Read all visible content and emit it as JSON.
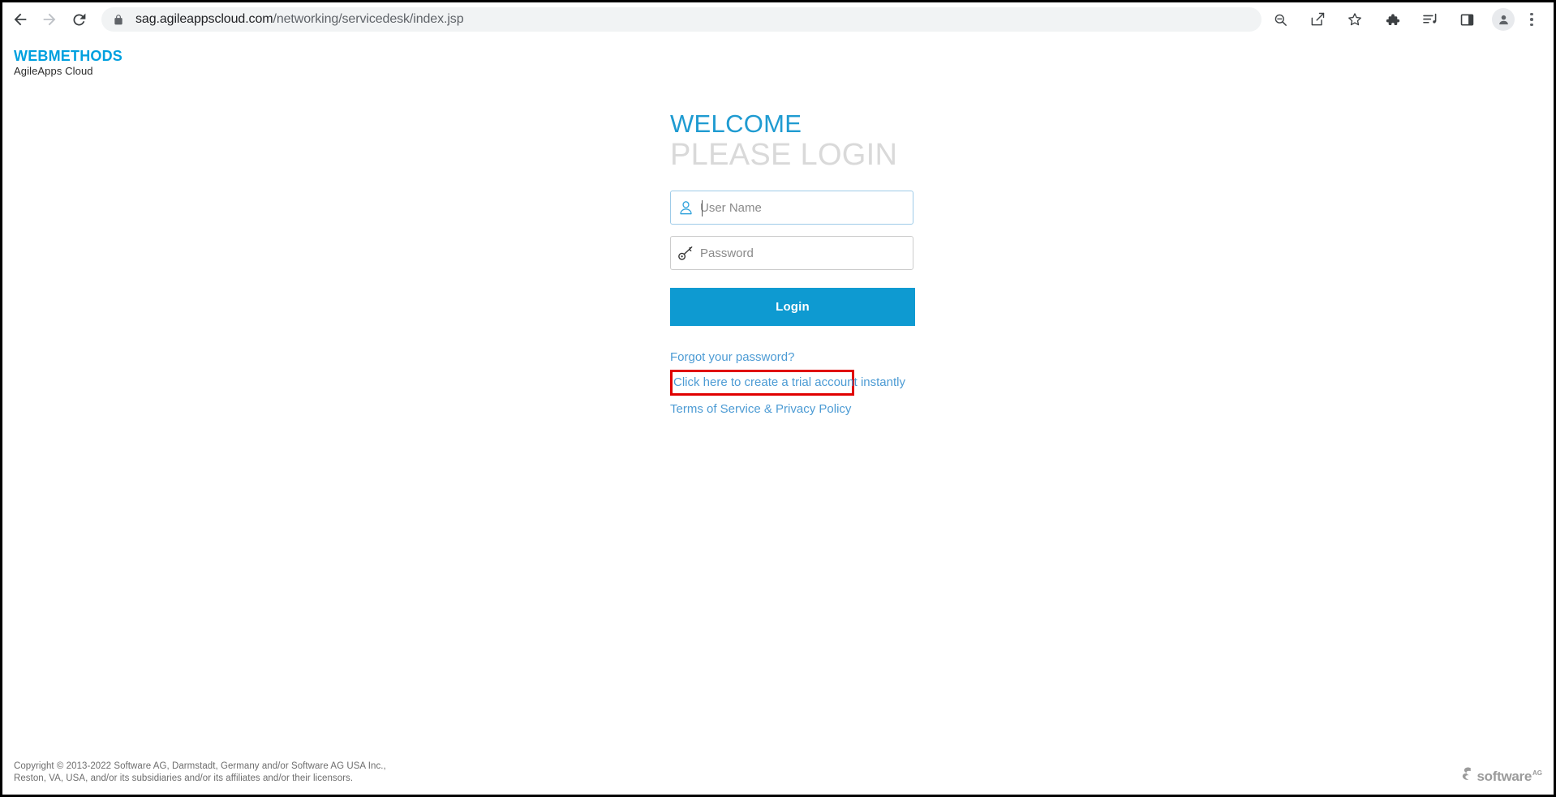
{
  "browser": {
    "back_label": "Back",
    "forward_label": "Forward",
    "reload_label": "Reload",
    "lock_label": "site-information",
    "url_host": "sag.agileappscloud.com",
    "url_path": "/networking/servicedesk/index.jsp",
    "url_full": "sag.agileappscloud.com/networking/servicedesk/index.jsp",
    "actions": [
      {
        "name": "zoom-out-icon",
        "label": "Zoom"
      },
      {
        "name": "share-icon",
        "label": "Share this page"
      },
      {
        "name": "bookmark-star-icon",
        "label": "Bookmark this tab"
      },
      {
        "name": "extensions-puzzle-icon",
        "label": "Extensions"
      },
      {
        "name": "media-playlist-icon",
        "label": "Media controls"
      },
      {
        "name": "side-panel-icon",
        "label": "Side panel"
      }
    ],
    "profile_label": "Profile",
    "menu_label": "Customize and control Google Chrome"
  },
  "brand": {
    "title": "WEBMETHODS",
    "subtitle": "AgileApps Cloud",
    "accent_color": "#00A0DF"
  },
  "login": {
    "welcome": "WELCOME",
    "please_login": "PLEASE LOGIN",
    "welcome_color": "#1F9BD1",
    "please_login_color": "#D9D9D9",
    "username": {
      "placeholder": "User Name",
      "value": "",
      "icon": "user-icon",
      "icon_color": "#33A3DC",
      "border_color": "#9ecbe8"
    },
    "password": {
      "placeholder": "Password",
      "value": "",
      "icon": "key-icon",
      "icon_color": "#333333",
      "border_color": "#cccccc"
    },
    "button_label": "Login",
    "button_color": "#0E9AD1",
    "links": {
      "forgot_password": "Forgot your password?",
      "trial_account": "Click here to create a trial account instantly",
      "terms_of_service": "Terms of Service",
      "separator": " & ",
      "privacy_policy": "Privacy Policy",
      "link_color": "#4C9BD4"
    },
    "highlight": {
      "target": "trial_account",
      "color": "#E00000"
    }
  },
  "footer": {
    "copyright_line1": "Copyright © 2013-2022 Software AG, Darmstadt, Germany and/or Software AG USA Inc.,",
    "copyright_line2": "Reston, VA, USA, and/or its subsidiaries and/or its affiliates and/or their licensors.",
    "logo_word": "software",
    "logo_suffix": "AG",
    "logo_color": "#9b9b9b"
  }
}
